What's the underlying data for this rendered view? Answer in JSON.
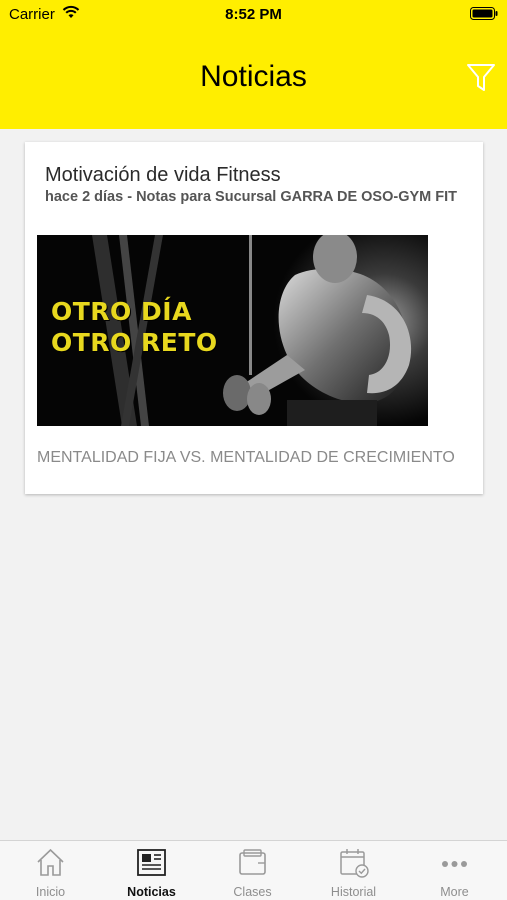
{
  "status_bar": {
    "carrier": "Carrier",
    "time": "8:52 PM"
  },
  "header": {
    "title": "Noticias",
    "filter_icon": "filter-icon"
  },
  "colors": {
    "header_bg": "#ffee00",
    "image_text": "#e8d81e",
    "background": "#f2f2f2"
  },
  "news": [
    {
      "title": "Motivación de vida Fitness",
      "meta": "hace 2 días - Notas para Sucursal GARRA DE OSO-GYM FIT",
      "image_text": [
        "OTRO DÍA",
        "OTRO RETO"
      ],
      "excerpt": "MENTALIDAD FIJA VS. MENTALIDAD DE CRECIMIENTO"
    }
  ],
  "tabs": [
    {
      "label": "Inicio",
      "icon": "home-icon",
      "active": false
    },
    {
      "label": "Noticias",
      "icon": "newspaper-icon",
      "active": true
    },
    {
      "label": "Clases",
      "icon": "wallet-icon",
      "active": false
    },
    {
      "label": "Historial",
      "icon": "calendar-check-icon",
      "active": false
    },
    {
      "label": "More",
      "icon": "more-icon",
      "active": false
    }
  ]
}
